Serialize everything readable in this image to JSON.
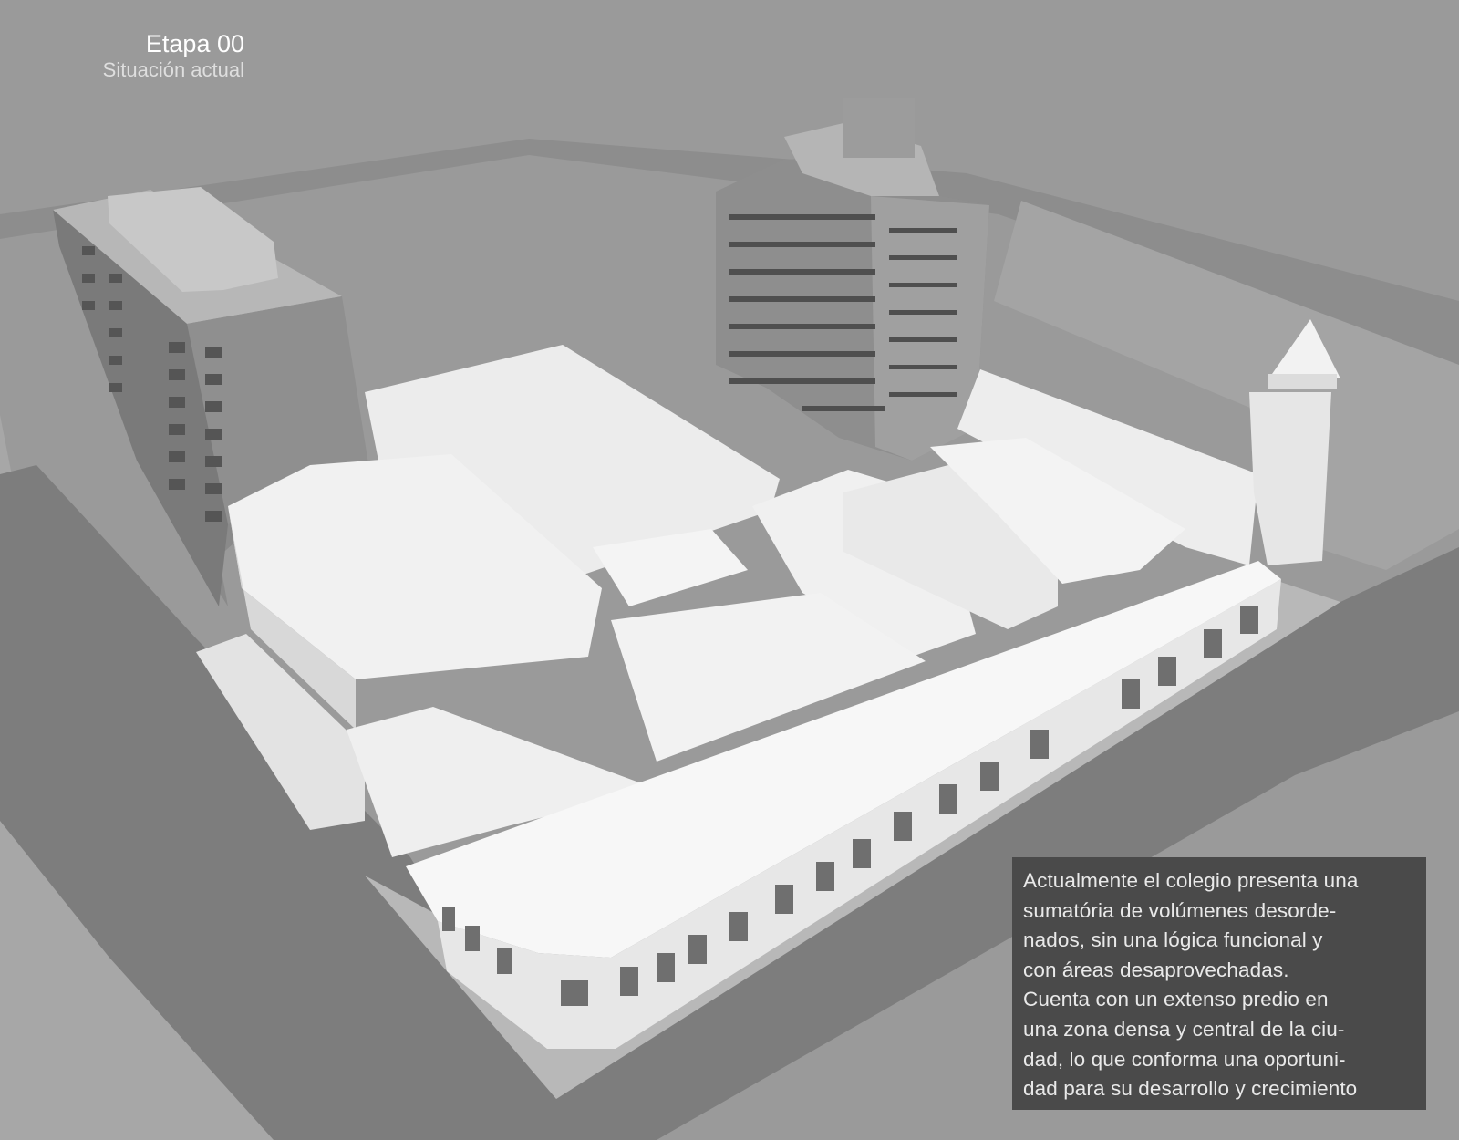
{
  "stage": {
    "title": "Etapa 00",
    "subtitle": "Situación actual"
  },
  "description": {
    "lines": [
      "Actualmente el colegio presenta una",
      "sumatória de volúmenes desorde-",
      "nados, sin una lógica funcional y",
      "con áreas desaprovechadas.",
      "Cuenta con un extenso predio en",
      "una zona densa y central de la ciu-",
      "dad, lo que conforma una oportuni-",
      "dad para su desarrollo y crecimiento"
    ]
  },
  "colors": {
    "background": "#9a9a9a",
    "street": "#7f7f7f",
    "sidewalk": "#a9a9a9",
    "building_white": "#f2f2f2",
    "tower_gray": "#8c8c8c",
    "text_box": "#4a4a4a",
    "text": "#e9e9e9"
  }
}
